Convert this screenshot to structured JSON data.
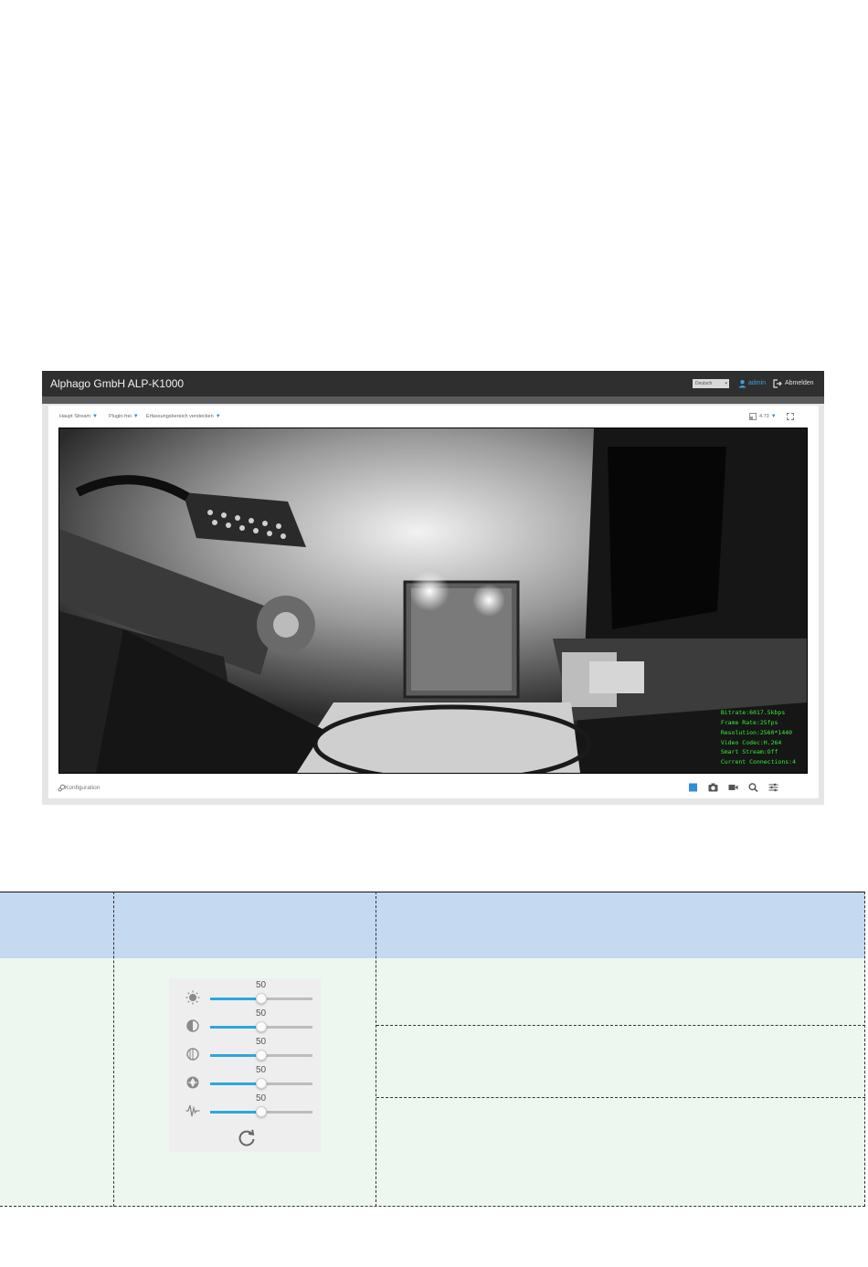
{
  "app": {
    "title": "Alphago GmbH ALP-K1000",
    "language": "Deutsch",
    "user": "admin",
    "logout": "Abmelden"
  },
  "toolbar": {
    "stream": "Haupt Stream",
    "plugin": "Plugin-frei",
    "capture_area": "Erfassungsbereich verstecken",
    "zoom": "4.73"
  },
  "video_overlay": [
    "Bitrate:6017.5kbps",
    "Frame Rate:25fps",
    "Resolution:2560*1440",
    "Video Codec:H.264",
    "Smart Stream:Off",
    "Current Connections:4"
  ],
  "footer": {
    "config": "Konfiguration"
  },
  "icons": {
    "brightness": "sun-icon",
    "contrast": "contrast-icon",
    "saturation": "saturation-icon",
    "sharpness": "sharpness-icon",
    "denoise": "noise-icon",
    "reset": "reset-icon"
  },
  "image_settings": {
    "sliders": [
      {
        "icon": "sun-icon",
        "value": "50",
        "level": 0.5
      },
      {
        "icon": "half-circle-icon",
        "value": "50",
        "level": 0.5
      },
      {
        "icon": "half-circle-outline-icon",
        "value": "50",
        "level": 0.5
      },
      {
        "icon": "aperture-icon",
        "value": "50",
        "level": 0.5
      },
      {
        "icon": "waveform-icon",
        "value": "50",
        "level": 0.5
      }
    ]
  },
  "colors": {
    "accent": "#2ea6dd",
    "header": "#2f2f2f",
    "overlay_text": "#39e83c",
    "table_header": "#c5d9f1",
    "table_body": "#edf7ef"
  }
}
